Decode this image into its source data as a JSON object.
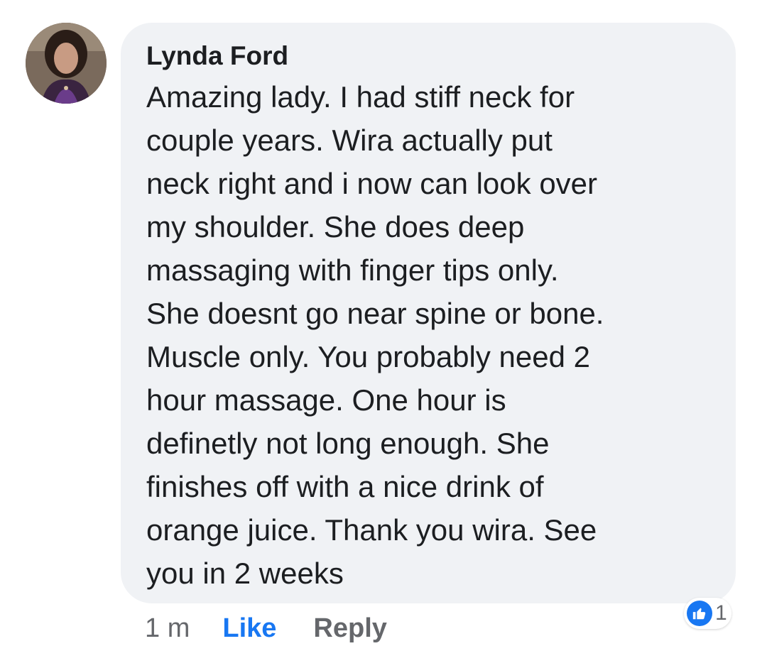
{
  "comment": {
    "author": "Lynda Ford",
    "lines": [
      "Amazing lady. I had stiff neck for",
      "couple years. Wira actually put",
      "neck right and i now can look over",
      "my shoulder.  She does deep",
      "massaging with finger tips only.",
      "She doesnt go near spine or bone.",
      "Muscle only.  You probably need 2",
      "hour massage. One hour is",
      "definetly not long enough.  She",
      "finishes off with a nice drink of",
      "orange juice. Thank you wira. See",
      "you in 2 weeks"
    ],
    "timestamp": "1 m",
    "like_label": "Like",
    "reply_label": "Reply",
    "reaction": {
      "icon": "thumbs-up-icon",
      "count": "1"
    }
  },
  "colors": {
    "bubble_bg": "#f0f2f5",
    "like_blue": "#1877f2",
    "muted": "#65676b",
    "text": "#1c1e21"
  }
}
